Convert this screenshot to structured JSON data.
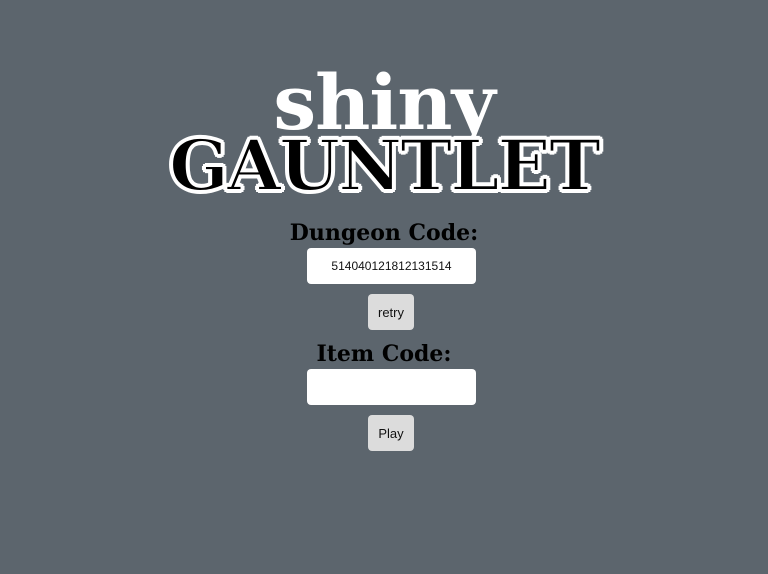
{
  "logo": {
    "top_word": "shiny",
    "bottom_word": "GAUNTLET"
  },
  "dungeon": {
    "label": "Dungeon Code:",
    "value": "514040121812131514",
    "retry_label": "retry"
  },
  "item": {
    "label": "Item Code:",
    "value": "",
    "play_label": "Play"
  },
  "colors": {
    "background": "#5c656d",
    "input_background": "#ffffff",
    "button_background": "#dcdcdc"
  }
}
